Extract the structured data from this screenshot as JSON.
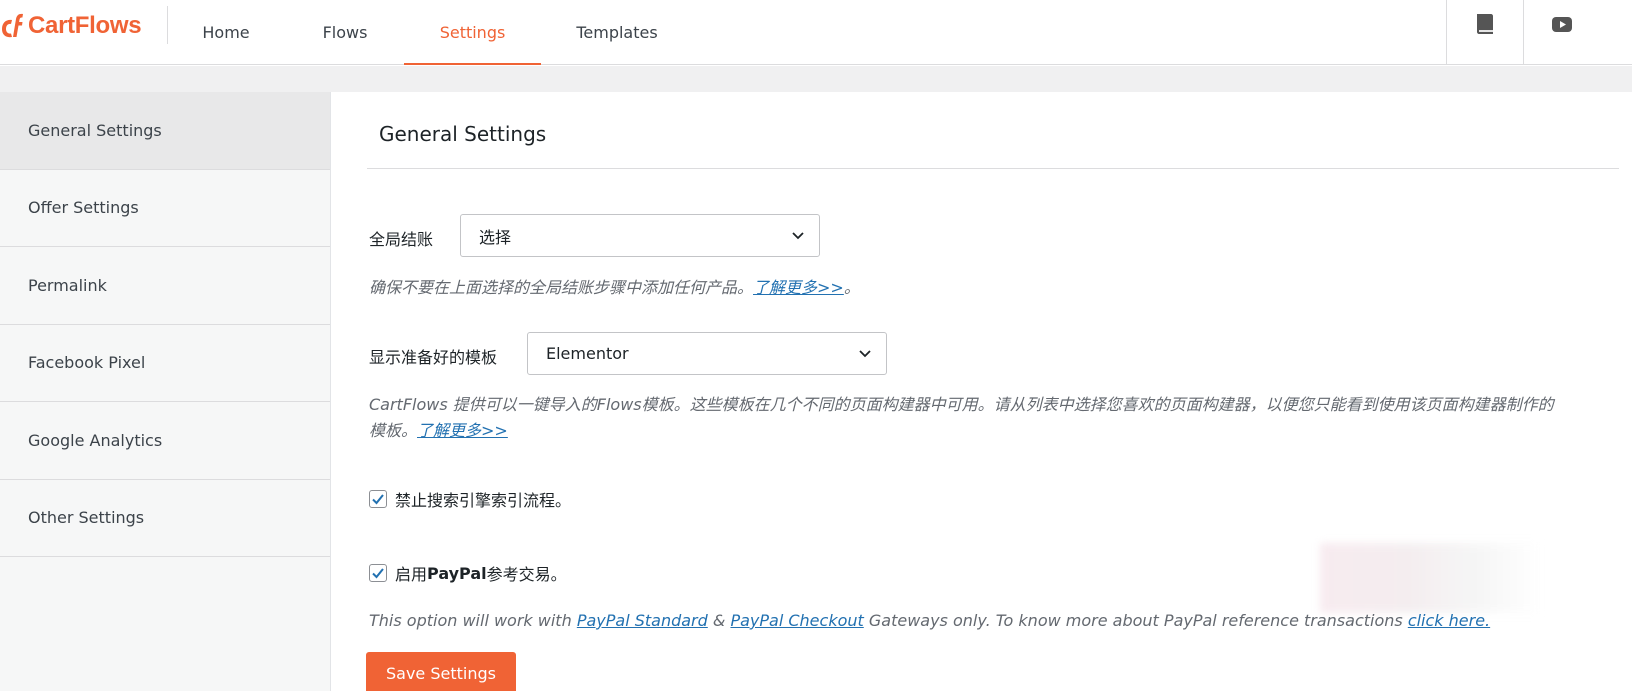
{
  "brand": {
    "name": "CartFlows",
    "accent": "#f06335",
    "link": "#2271b1"
  },
  "nav": {
    "tabs": [
      {
        "label": "Home"
      },
      {
        "label": "Flows"
      },
      {
        "label": "Settings",
        "active": true
      },
      {
        "label": "Templates"
      }
    ],
    "icons": [
      "book-icon",
      "youtube-icon"
    ]
  },
  "sidebar": {
    "items": [
      {
        "label": "General Settings",
        "active": true
      },
      {
        "label": "Offer Settings"
      },
      {
        "label": "Permalink"
      },
      {
        "label": "Facebook Pixel"
      },
      {
        "label": "Google Analytics"
      },
      {
        "label": "Other Settings"
      }
    ]
  },
  "main": {
    "title": "General Settings",
    "global_checkout": {
      "label": "全局结账",
      "selected": "选择",
      "desc": "确保不要在上面选择的全局结账步骤中添加任何产品。",
      "link": "了解更多>>",
      "suffix": "。"
    },
    "templates": {
      "label": "显示准备好的模板",
      "selected": "Elementor",
      "desc_line1": "CartFlows 提供可以一键导入的Flows模板。这些模板在几个不同的页面构建器中可用。请从列表中选择您喜欢的页面构建器，以便您只能看到使用该页面构建器制作的",
      "desc_line2": "模板。",
      "link": "了解更多>>"
    },
    "disallow_indexing": {
      "label": "禁止搜索引擎索引流程。",
      "checked": true
    },
    "paypal": {
      "label_pre": "启用",
      "label_bold": "PayPal",
      "label_post": "参考交易。",
      "checked": true,
      "note_pre": "This option will work with ",
      "link1": "PayPal Standard",
      "amp": " & ",
      "link2": "PayPal Checkout",
      "note_mid": " Gateways only. To know more about PayPal reference transactions ",
      "link3": "click here."
    },
    "save_label": "Save Settings"
  }
}
